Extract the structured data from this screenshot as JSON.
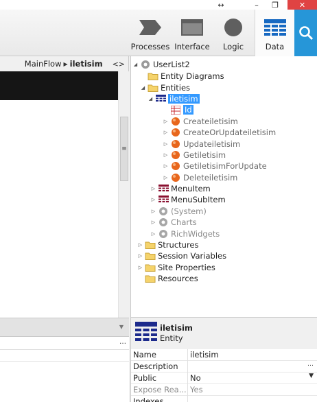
{
  "toolbar": {
    "tabs": [
      {
        "label": "Processes",
        "icon": "processes-icon"
      },
      {
        "label": "Interface",
        "icon": "interface-icon"
      },
      {
        "label": "Logic",
        "icon": "logic-icon"
      },
      {
        "label": "Data",
        "icon": "data-icon",
        "active": true
      }
    ],
    "search_icon": "search-icon",
    "accent": "#2696d8"
  },
  "breadcrumb": {
    "flow": "MainFlow",
    "current": "iletisim",
    "toggle": "<>"
  },
  "tree": {
    "root": "UserList2",
    "entity_diagrams": "Entity Diagrams",
    "entities": "Entities",
    "entity_selected": "iletisim",
    "attribute_id": "Id",
    "actions": [
      "Createiletisim",
      "CreateOrUpdateiletisim",
      "Updateiletisim",
      "Getiletisim",
      "GetiletisimForUpdate",
      "Deleteiletisim"
    ],
    "menu_item": "MenuItem",
    "menu_sub_item": "MenuSubItem",
    "system": "(System)",
    "charts": "Charts",
    "rich_widgets": "RichWidgets",
    "structures": "Structures",
    "session_variables": "Session Variables",
    "site_properties": "Site Properties",
    "resources": "Resources"
  },
  "properties": {
    "title": "iletisim",
    "subtitle": "Entity",
    "rows": [
      {
        "key": "Name",
        "value": "iletisim"
      },
      {
        "key": "Description",
        "value": ""
      },
      {
        "key": "Public",
        "value": "No"
      },
      {
        "key": "Expose Rea...",
        "value": "Yes"
      },
      {
        "key": "Indexes",
        "value": ""
      }
    ]
  },
  "window": {
    "resize_glyph": "↔",
    "minimize_glyph": "–",
    "maximize_glyph": "❐",
    "close_glyph": "✕"
  },
  "colors": {
    "selection": "#3399ff",
    "close": "#e04343",
    "entity_icon": "#1c2a8c"
  }
}
